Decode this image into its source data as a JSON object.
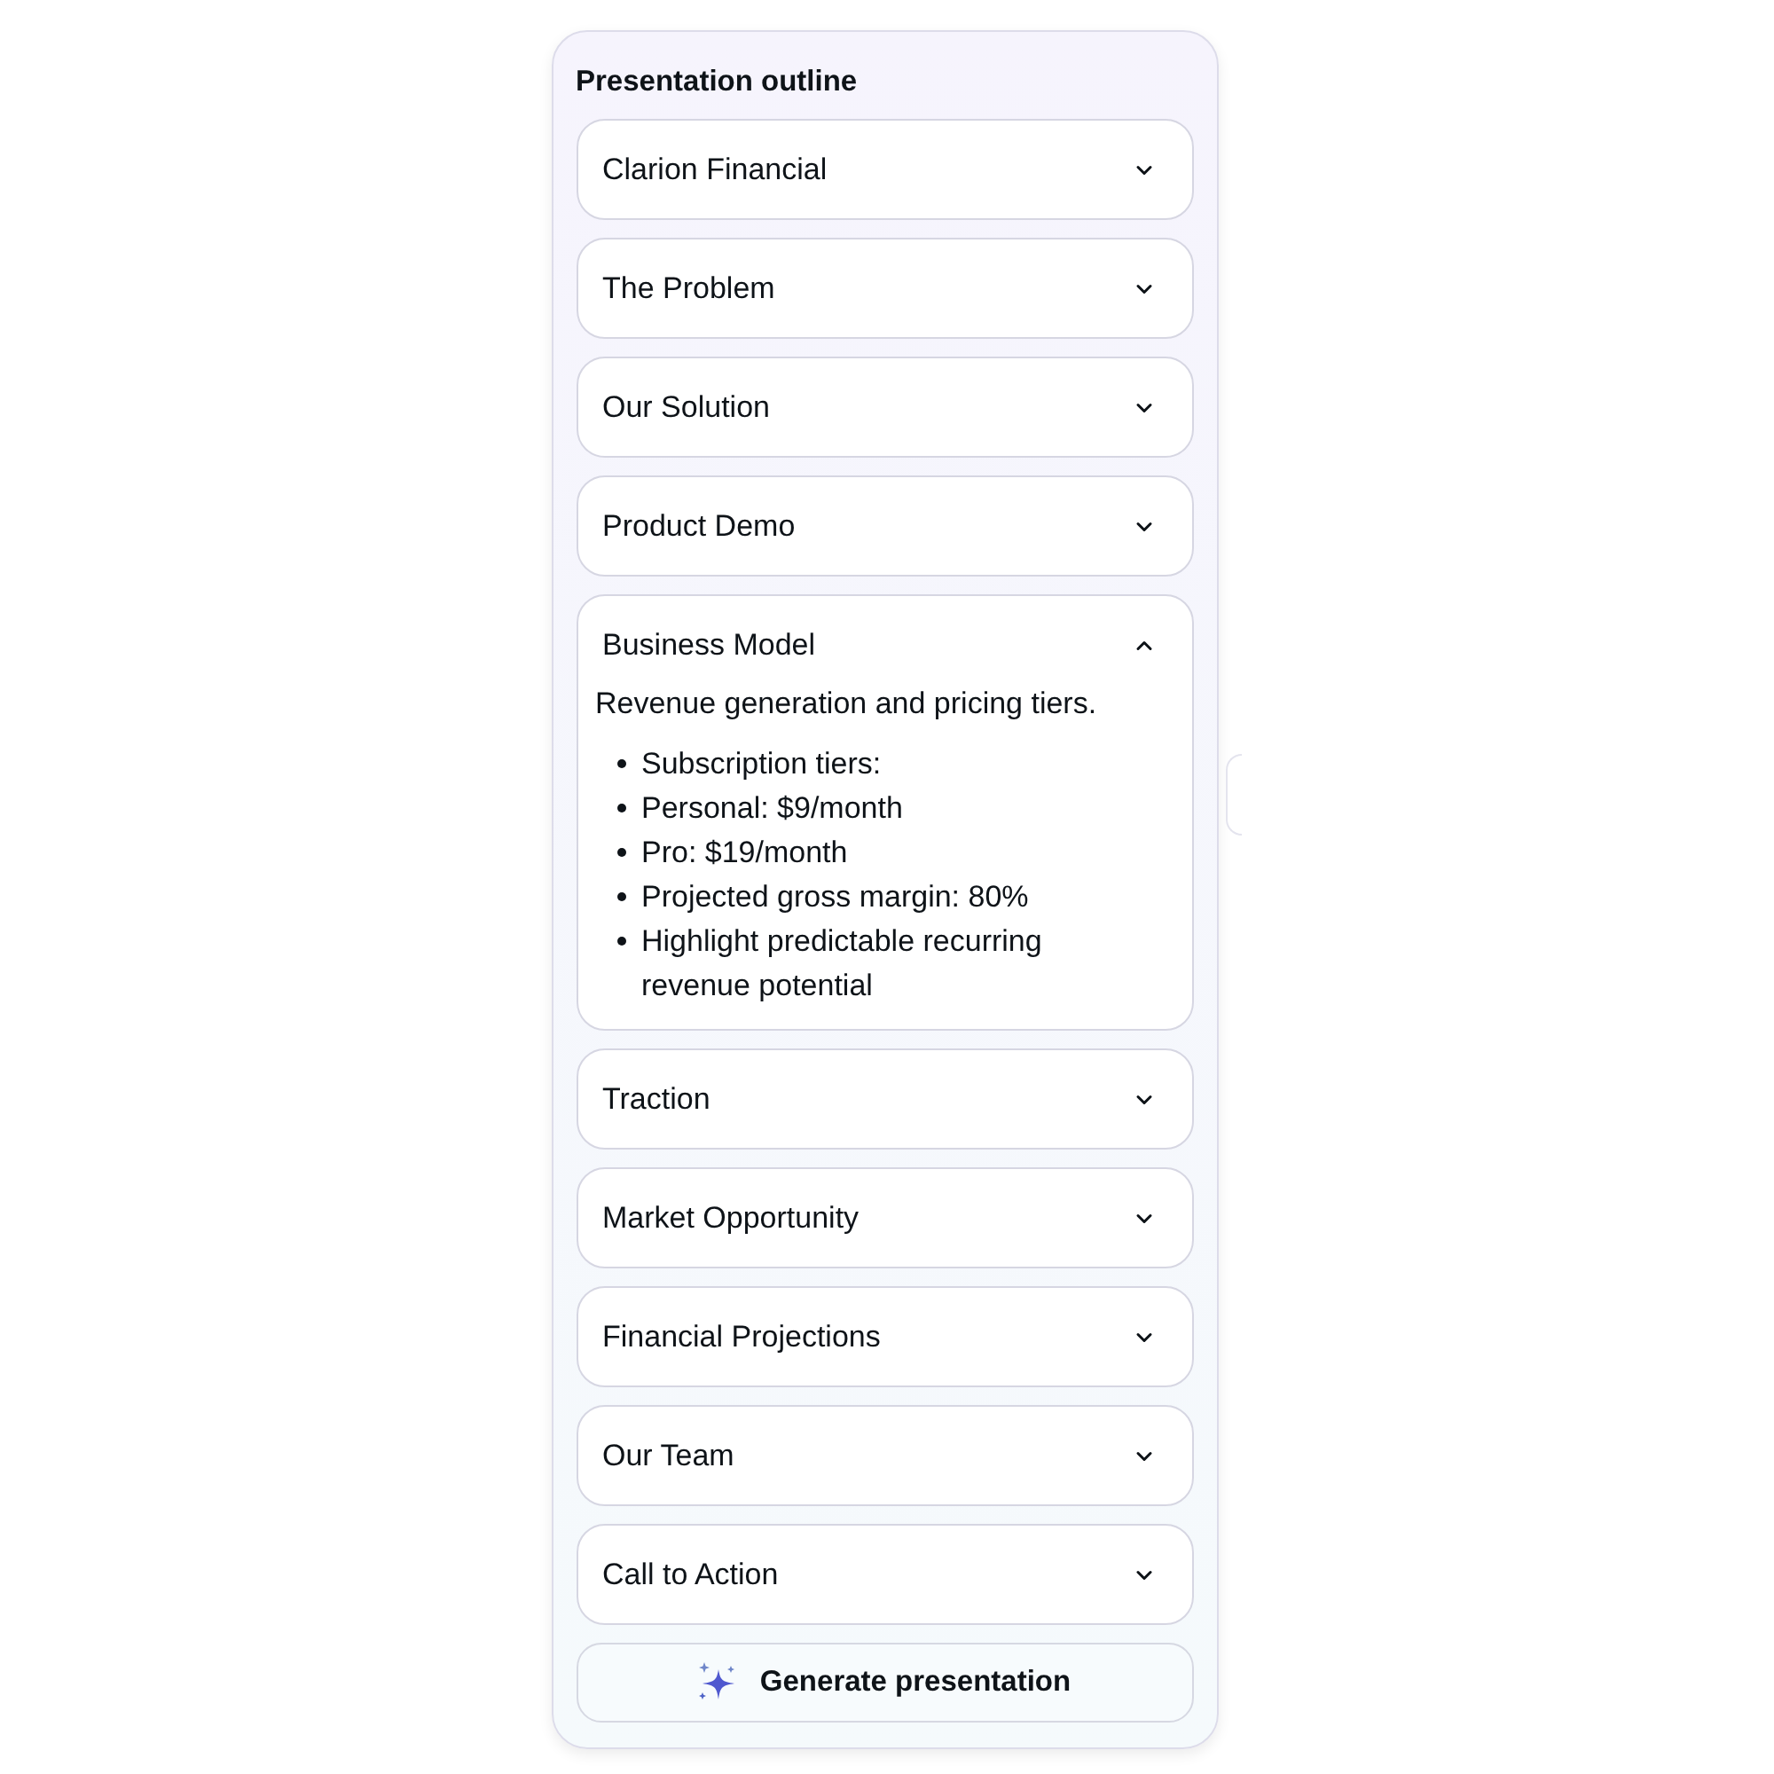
{
  "panel": {
    "title": "Presentation outline"
  },
  "sections": [
    {
      "title": "Clarion Financial",
      "expanded": false
    },
    {
      "title": "The Problem",
      "expanded": false
    },
    {
      "title": "Our Solution",
      "expanded": false
    },
    {
      "title": "Product Demo",
      "expanded": false
    },
    {
      "title": "Business Model",
      "expanded": true,
      "summary": "Revenue generation and pricing tiers.",
      "points": [
        "Subscription tiers:",
        "Personal: $9/month",
        "Pro: $19/month",
        "Projected gross margin: 80%",
        "Highlight predictable recurring revenue potential"
      ]
    },
    {
      "title": "Traction",
      "expanded": false
    },
    {
      "title": "Market Opportunity",
      "expanded": false
    },
    {
      "title": "Financial Projections",
      "expanded": false
    },
    {
      "title": "Our Team",
      "expanded": false
    },
    {
      "title": "Call to Action",
      "expanded": false
    }
  ],
  "generate_button": {
    "label": "Generate presentation"
  }
}
